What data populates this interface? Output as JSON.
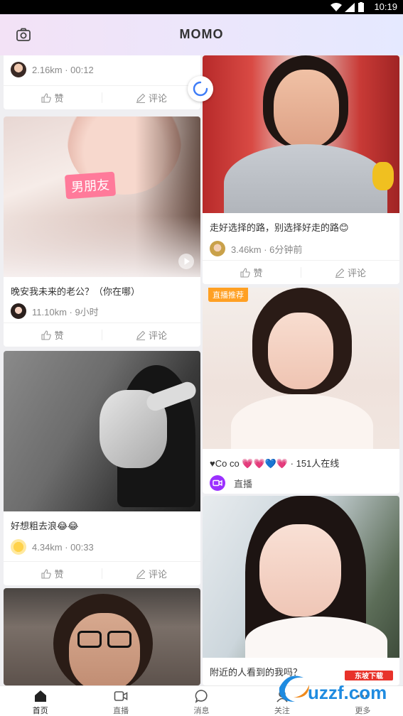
{
  "status_bar": {
    "time": "10:19"
  },
  "header": {
    "title": "MOMO"
  },
  "cards": {
    "c1": {
      "caption": "...",
      "distance": "2.16km · 00:12",
      "like": "赞",
      "comment": "评论"
    },
    "c2": {
      "caption": "晚安我未来的老公？（你在哪）",
      "distance": "11.10km · 9小时",
      "like": "赞",
      "comment": "评论",
      "tag": "男朋友"
    },
    "c3": {
      "caption": "好想粗去浪😂😂",
      "distance": "4.34km · 00:33",
      "like": "赞",
      "comment": "评论"
    },
    "r1": {
      "caption": "走好选择的路，别选择好走的路😊",
      "distance": "3.46km · 6分钟前",
      "like": "赞",
      "comment": "评论"
    },
    "r2": {
      "badge": "直播推荐",
      "caption": "♥Co co 💗💗💙💗 · 151人在线",
      "live_label": "直播"
    },
    "r3": {
      "caption": "附近的人看到的我吗？"
    }
  },
  "tabs": [
    {
      "label": "首页",
      "icon": "home-icon"
    },
    {
      "label": "直播",
      "icon": "video-icon"
    },
    {
      "label": "消息",
      "icon": "chat-icon"
    },
    {
      "label": "关注",
      "icon": "follow-icon"
    },
    {
      "label": "更多",
      "icon": "more-icon"
    }
  ],
  "watermark": {
    "text": "uzzf.com",
    "sub": "东坡下载"
  },
  "colors": {
    "accent_live": "#ffa023",
    "live_icon": "#9b30ff",
    "tag_pink": "#ff7a9a"
  }
}
